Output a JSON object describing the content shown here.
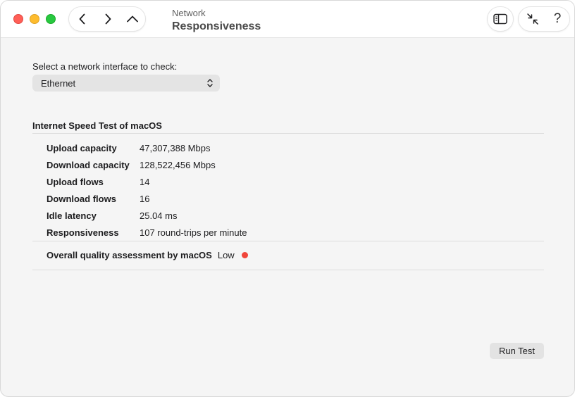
{
  "window": {
    "controls": [
      "close",
      "minimize",
      "zoom"
    ]
  },
  "toolbar": {
    "nav_icons": [
      "chevron-left-icon",
      "chevron-right-icon",
      "chevron-up-icon"
    ],
    "title_small": "Network",
    "title_large": "Responsiveness",
    "sidebar_icon": "sidebar-toggle-icon",
    "collapse_icon": "collapse-arrows-icon",
    "help_label": "?"
  },
  "interface": {
    "label": "Select a network interface to check:",
    "selected": "Ethernet",
    "chevron_icon": "updown-chevron-icon"
  },
  "results": {
    "title": "Internet Speed Test of macOS",
    "rows": [
      {
        "label": "Upload capacity",
        "value": "47,307,388 Mbps"
      },
      {
        "label": "Download capacity",
        "value": "128,522,456 Mbps"
      },
      {
        "label": "Upload flows",
        "value": "14"
      },
      {
        "label": "Download flows",
        "value": "16"
      },
      {
        "label": "Idle latency",
        "value": "25.04 ms"
      },
      {
        "label": "Responsiveness",
        "value": "107 round-trips per minute"
      }
    ],
    "overall_label": "Overall quality assessment by macOS",
    "overall_value": "Low",
    "overall_color": "#f0453a"
  },
  "actions": {
    "run_test_label": "Run Test"
  }
}
